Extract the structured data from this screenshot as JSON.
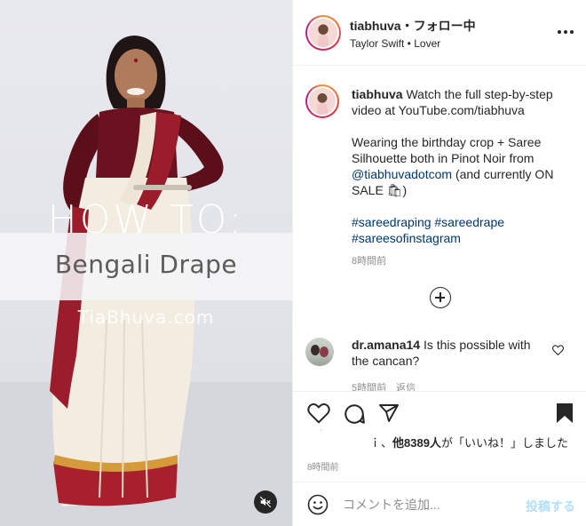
{
  "media": {
    "overlay_heading": "HOW TO:",
    "overlay_title": "Bengali Drape",
    "watermark": "TiaBhuva.com",
    "mute_icon": "volume-muted-icon"
  },
  "header": {
    "username": "tiabhuva",
    "separator": "・",
    "follow_status": "フォロー中",
    "song": "Taylor Swift • Lover",
    "more_icon": "more-horizontal-icon"
  },
  "caption": {
    "username": "tiabhuva",
    "line1": "Watch the full step-by-step video at YouTube.com/tiabhuva",
    "line2_prefix": "Wearing the birthday crop + Saree Silhouette both in Pinot Noir from ",
    "mention": "@tiabhuvadotcom",
    "line2_suffix": " (and currently ON SALE 🛍)",
    "hashtags": "#sareedraping #sareedrape #sareesofinstagram",
    "time": "8時間前"
  },
  "load_more_icon": "plus-circle-icon",
  "comment": {
    "username": "dr.amana14",
    "text": "Is this possible with the cancan?",
    "meta": "5時間前　返信"
  },
  "actions": {
    "like_icon": "heart-icon",
    "comment_icon": "comment-icon",
    "share_icon": "share-icon",
    "save_icon": "bookmark-icon"
  },
  "likes": {
    "prefix": "ｉ、",
    "bold": "他8389人",
    "suffix": "が「いいね！」しました"
  },
  "post_time": "8時間前",
  "add_comment": {
    "placeholder": "コメントを追加...",
    "post_label": "投稿する"
  }
}
